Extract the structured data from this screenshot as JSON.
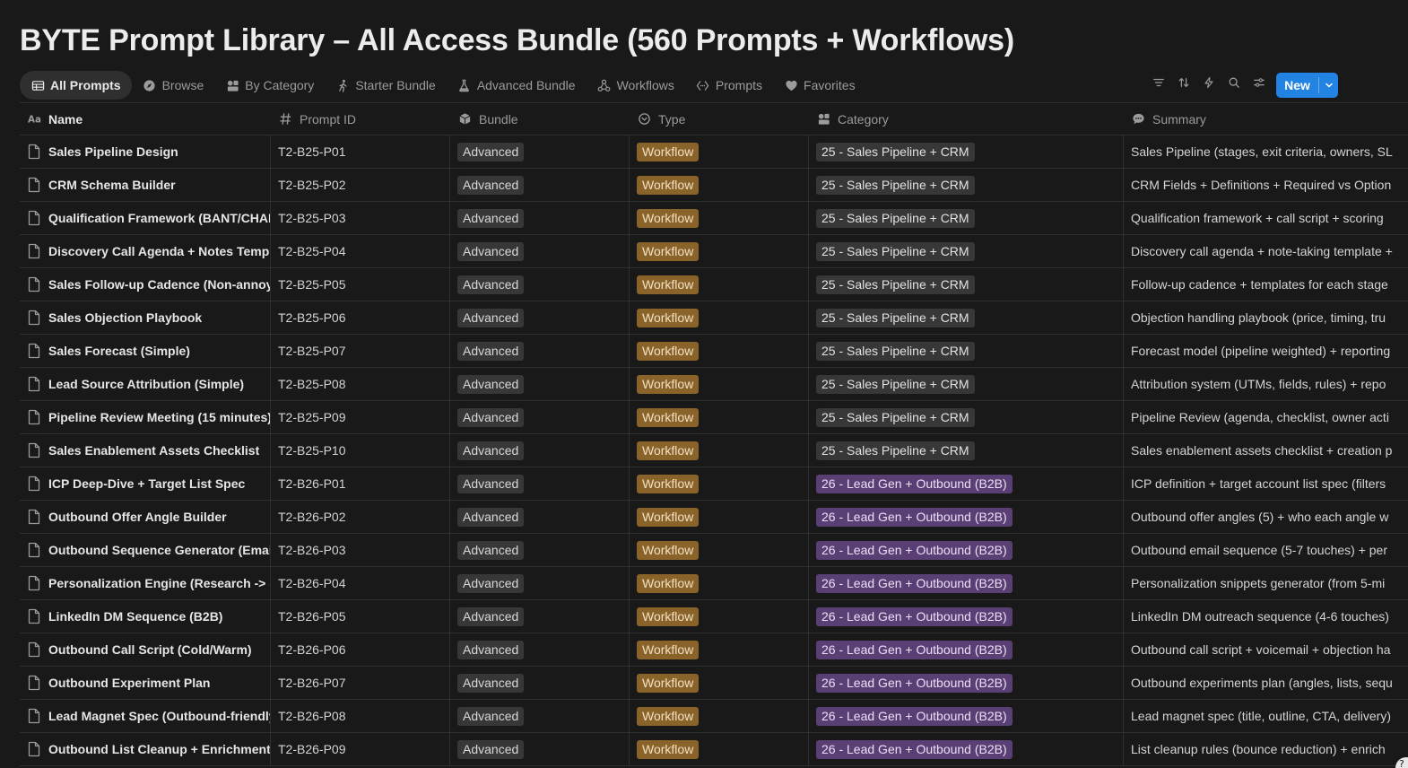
{
  "page": {
    "title": "BYTE Prompt Library – All Access Bundle (560 Prompts + Workflows)"
  },
  "tabs": [
    {
      "label": "All Prompts",
      "icon": "table-icon",
      "active": true
    },
    {
      "label": "Browse",
      "icon": "compass-icon"
    },
    {
      "label": "By Category",
      "icon": "shapes-icon"
    },
    {
      "label": "Starter Bundle",
      "icon": "person-walk-icon"
    },
    {
      "label": "Advanced Bundle",
      "icon": "flask-icon"
    },
    {
      "label": "Workflows",
      "icon": "workflow-icon"
    },
    {
      "label": "Prompts",
      "icon": "code-brackets-icon"
    },
    {
      "label": "Favorites",
      "icon": "heart-icon"
    }
  ],
  "toolbar": {
    "new_label": "New",
    "icons": [
      "filter-icon",
      "sort-icon",
      "lightning-icon",
      "search-icon",
      "settings-sliders-icon"
    ]
  },
  "columns": [
    {
      "label": "Name",
      "icon": "text-aa-icon"
    },
    {
      "label": "Prompt ID",
      "icon": "hash-icon"
    },
    {
      "label": "Bundle",
      "icon": "box-icon"
    },
    {
      "label": "Type",
      "icon": "select-circle-icon"
    },
    {
      "label": "Category",
      "icon": "shapes-icon"
    },
    {
      "label": "Summary",
      "icon": "chat-bubble-icon"
    }
  ],
  "colors": {
    "accent": "#2383e2",
    "workflow_pill": "#89632a",
    "category_26_pill": "#5a3f75",
    "neutral_pill": "#373737"
  },
  "rows": [
    {
      "name": "Sales Pipeline Design",
      "id": "T2-B25-P01",
      "bundle": "Advanced",
      "type": "Workflow",
      "category": "25 - Sales Pipeline + CRM",
      "cat_group": 25,
      "summary": "Sales Pipeline (stages, exit criteria, owners, SL"
    },
    {
      "name": "CRM Schema Builder",
      "id": "T2-B25-P02",
      "bundle": "Advanced",
      "type": "Workflow",
      "category": "25 - Sales Pipeline + CRM",
      "cat_group": 25,
      "summary": "CRM Fields + Definitions + Required vs Option"
    },
    {
      "name": "Qualification Framework (BANT/CHAMP",
      "id": "T2-B25-P03",
      "bundle": "Advanced",
      "type": "Workflow",
      "category": "25 - Sales Pipeline + CRM",
      "cat_group": 25,
      "summary": "Qualification framework + call script + scoring"
    },
    {
      "name": "Discovery Call Agenda + Notes Templa",
      "id": "T2-B25-P04",
      "bundle": "Advanced",
      "type": "Workflow",
      "category": "25 - Sales Pipeline + CRM",
      "cat_group": 25,
      "summary": "Discovery call agenda + note-taking template +"
    },
    {
      "name": "Sales Follow-up Cadence (Non-annoy",
      "id": "T2-B25-P05",
      "bundle": "Advanced",
      "type": "Workflow",
      "category": "25 - Sales Pipeline + CRM",
      "cat_group": 25,
      "summary": "Follow-up cadence + templates for each stage"
    },
    {
      "name": "Sales Objection Playbook",
      "id": "T2-B25-P06",
      "bundle": "Advanced",
      "type": "Workflow",
      "category": "25 - Sales Pipeline + CRM",
      "cat_group": 25,
      "summary": "Objection handling playbook (price, timing, tru"
    },
    {
      "name": "Sales Forecast (Simple)",
      "id": "T2-B25-P07",
      "bundle": "Advanced",
      "type": "Workflow",
      "category": "25 - Sales Pipeline + CRM",
      "cat_group": 25,
      "summary": "Forecast model (pipeline weighted) + reporting"
    },
    {
      "name": "Lead Source Attribution (Simple)",
      "id": "T2-B25-P08",
      "bundle": "Advanced",
      "type": "Workflow",
      "category": "25 - Sales Pipeline + CRM",
      "cat_group": 25,
      "summary": "Attribution system (UTMs, fields, rules) + repo"
    },
    {
      "name": "Pipeline Review Meeting (15 minutes)",
      "id": "T2-B25-P09",
      "bundle": "Advanced",
      "type": "Workflow",
      "category": "25 - Sales Pipeline + CRM",
      "cat_group": 25,
      "summary": "Pipeline Review (agenda, checklist, owner acti"
    },
    {
      "name": "Sales Enablement Assets Checklist",
      "id": "T2-B25-P10",
      "bundle": "Advanced",
      "type": "Workflow",
      "category": "25 - Sales Pipeline + CRM",
      "cat_group": 25,
      "summary": "Sales enablement assets checklist + creation p"
    },
    {
      "name": "ICP Deep-Dive + Target List Spec",
      "id": "T2-B26-P01",
      "bundle": "Advanced",
      "type": "Workflow",
      "category": "26 - Lead Gen + Outbound (B2B)",
      "cat_group": 26,
      "summary": "ICP definition + target account list spec (filters"
    },
    {
      "name": "Outbound Offer Angle Builder",
      "id": "T2-B26-P02",
      "bundle": "Advanced",
      "type": "Workflow",
      "category": "26 - Lead Gen + Outbound (B2B)",
      "cat_group": 26,
      "summary": "Outbound offer angles (5) + who each angle w"
    },
    {
      "name": "Outbound Sequence Generator (Email",
      "id": "T2-B26-P03",
      "bundle": "Advanced",
      "type": "Workflow",
      "category": "26 - Lead Gen + Outbound (B2B)",
      "cat_group": 26,
      "summary": "Outbound email sequence (5-7 touches) + per"
    },
    {
      "name": "Personalization Engine (Research -> S",
      "id": "T2-B26-P04",
      "bundle": "Advanced",
      "type": "Workflow",
      "category": "26 - Lead Gen + Outbound (B2B)",
      "cat_group": 26,
      "summary": "Personalization snippets generator (from 5-mi"
    },
    {
      "name": "LinkedIn DM Sequence (B2B)",
      "id": "T2-B26-P05",
      "bundle": "Advanced",
      "type": "Workflow",
      "category": "26 - Lead Gen + Outbound (B2B)",
      "cat_group": 26,
      "summary": "LinkedIn DM outreach sequence (4-6 touches)"
    },
    {
      "name": "Outbound Call Script (Cold/Warm)",
      "id": "T2-B26-P06",
      "bundle": "Advanced",
      "type": "Workflow",
      "category": "26 - Lead Gen + Outbound (B2B)",
      "cat_group": 26,
      "summary": "Outbound call script + voicemail + objection ha"
    },
    {
      "name": "Outbound Experiment Plan",
      "id": "T2-B26-P07",
      "bundle": "Advanced",
      "type": "Workflow",
      "category": "26 - Lead Gen + Outbound (B2B)",
      "cat_group": 26,
      "summary": "Outbound experiments plan (angles, lists, sequ"
    },
    {
      "name": "Lead Magnet Spec (Outbound-friendly",
      "id": "T2-B26-P08",
      "bundle": "Advanced",
      "type": "Workflow",
      "category": "26 - Lead Gen + Outbound (B2B)",
      "cat_group": 26,
      "summary": "Lead magnet spec (title, outline, CTA, delivery)"
    },
    {
      "name": "Outbound List Cleanup + Enrichment",
      "id": "T2-B26-P09",
      "bundle": "Advanced",
      "type": "Workflow",
      "category": "26 - Lead Gen + Outbound (B2B)",
      "cat_group": 26,
      "summary": "List cleanup rules (bounce reduction) + enrich"
    }
  ]
}
